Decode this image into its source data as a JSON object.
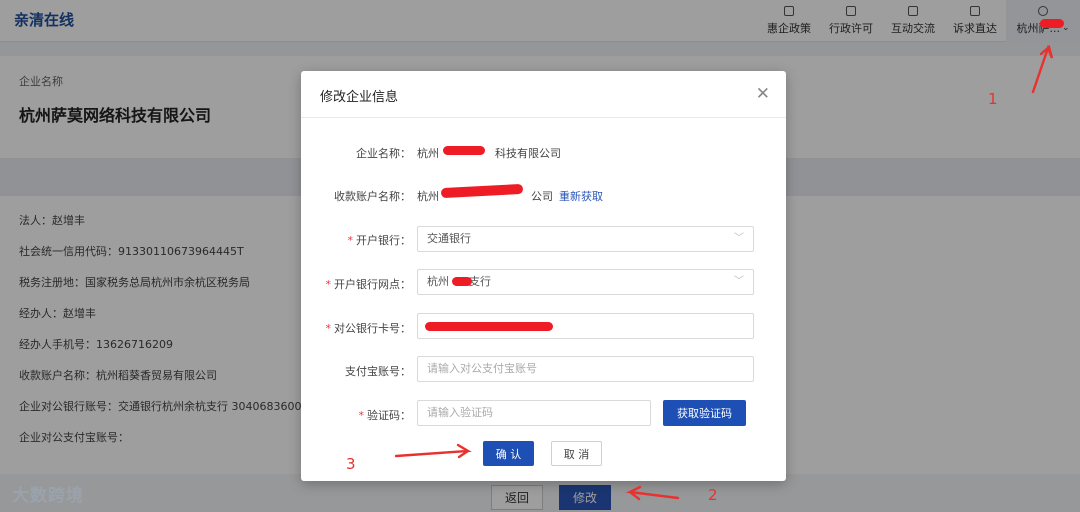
{
  "header": {
    "brand": "亲清在线",
    "nav": [
      {
        "label": "惠企政策",
        "icon": "document-icon"
      },
      {
        "label": "行政许可",
        "icon": "shield-icon"
      },
      {
        "label": "互动交流",
        "icon": "chat-icon"
      },
      {
        "label": "诉求直达",
        "icon": "exit-icon"
      }
    ],
    "user": {
      "label": "杭州萨...",
      "icon": "user-icon"
    }
  },
  "company": {
    "name_label": "企业名称",
    "name": "杭州萨莫网络科技有限公司"
  },
  "info": {
    "legal_person": "法人：赵增丰",
    "credit_code": "社会统一信用代码：91330110673964445T",
    "tax_office": "税务注册地：国家税务总局杭州市余杭区税务局",
    "agent": "经办人：赵增丰",
    "agent_phone": "经办人手机号：13626716209",
    "receive_account": "收款账户名称：杭州稻葵香贸易有限公司",
    "bank_account": "企业对公银行账号：交通银行杭州余杭支行 3040683600",
    "alipay_account": "企业对公支付宝账号："
  },
  "footer": {
    "back_label": "返回",
    "edit_label": "修改"
  },
  "watermark": "大数跨境",
  "modal": {
    "title": "修改企业信息",
    "fields": {
      "company_name_label": "企业名称：",
      "company_name_value": "杭州",
      "company_name_suffix": "科技有限公司",
      "account_name_label": "收款账户名称：",
      "account_name_value": "杭州",
      "account_name_suffix": "公司",
      "refresh_link": "重新获取",
      "bank_label": "开户银行：",
      "bank_value": "交通银行",
      "branch_label": "开户银行网点：",
      "branch_value": "杭州",
      "branch_suffix": "支行",
      "card_label": "对公银行卡号：",
      "alipay_label": "支付宝账号：",
      "alipay_placeholder": "请输入对公支付宝账号",
      "code_label": "验证码：",
      "code_placeholder": "请输入验证码",
      "get_code": "获取验证码"
    },
    "confirm_label": "确 认",
    "cancel_label": "取 消"
  },
  "annotations": {
    "step1": "1",
    "step2": "2",
    "step3": "3"
  },
  "colors": {
    "primary": "#1d4fb5",
    "brand": "#1f4e9c",
    "required": "#e4393c",
    "redaction": "#ee1c25",
    "annotation": "#e8322f"
  }
}
